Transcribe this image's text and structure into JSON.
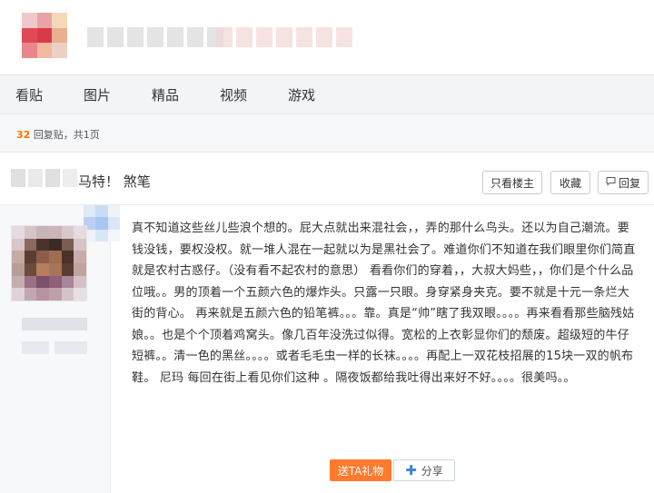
{
  "nav": {
    "items": [
      "看贴",
      "图片",
      "精品",
      "视频",
      "游戏"
    ]
  },
  "countbar": {
    "count": "32",
    "suffix": "回复贴，共1页"
  },
  "thread": {
    "title": "马特！ 煞笔",
    "buttons": {
      "only_op": "只看楼主",
      "favorite": "收藏",
      "reply": "回复"
    }
  },
  "post": {
    "body": "真不知道这些丝儿些浪个想的。屁大点就出来混社会，，弄的那什么鸟头。还以为自己潮流。要钱没钱，要权没权。就一堆人混在一起就以为是黑社会了。难道你们不知道在我们眼里你们简直就是农村古惑仔。（没有看不起农村的意思） 看看你们的穿着，，大叔大妈些，，你们是个什么品位哦。。男的顶着一个五颜六色的爆炸头。只露一只眼。身穿紧身夹克。要不就是十元一条烂大街的背心。 再来就是五颜六色的铅笔裤。。。靠。真是“帅”瞎了我双眼。。。。再来看看那些脑残姑娘。。也是个个顶着鸡窝头。像几百年没洗过似得。宽松的上衣彰显你们的颓废。超级短的牛仔短裤。。清一色的黑丝。。。。或者毛毛虫一样的长袜。。。。再配上一双花枝招展的15块一双的帆布鞋。 尼玛 每回在街上看见你们这种 。隔夜饭都给我吐得出来好不好。。。。很美吗。。"
  },
  "actions": {
    "gift": "送TA礼物",
    "share": "分享"
  },
  "icons": {
    "reply": "reply-bubble-icon",
    "share": "plus-icon"
  },
  "colors": {
    "accent_orange": "#ff7a2c",
    "count_orange": "#ff7300",
    "nav_bg": "#f2f4f6"
  }
}
